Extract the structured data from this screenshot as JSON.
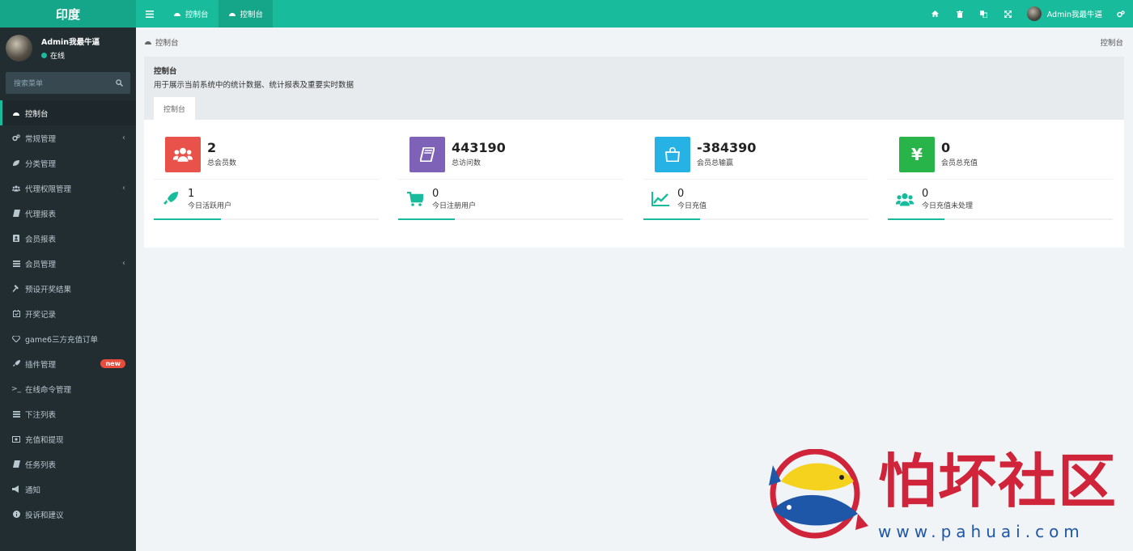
{
  "app": {
    "brand": "印度",
    "top_tabs": [
      {
        "label": "控制台",
        "active": false
      },
      {
        "label": "控制台",
        "active": true
      }
    ],
    "user_name": "Admin我最牛逼",
    "icons": [
      "home-icon",
      "trash-icon",
      "language-icon",
      "fullscreen-icon",
      "settings-icon"
    ]
  },
  "sidebar": {
    "user_name": "Admin我最牛逼",
    "status": "在线",
    "search_placeholder": "搜索菜单",
    "items": [
      {
        "label": "控制台",
        "active": true
      },
      {
        "label": "常规管理",
        "chevron": true
      },
      {
        "label": "分类管理"
      },
      {
        "label": "代理权限管理",
        "chevron": true
      },
      {
        "label": "代理报表"
      },
      {
        "label": "会员报表"
      },
      {
        "label": "会员管理",
        "chevron": true
      },
      {
        "label": "预设开奖结果"
      },
      {
        "label": "开奖记录"
      },
      {
        "label": "game6三方充值订单"
      },
      {
        "label": "插件管理",
        "badge": "new"
      },
      {
        "label": "在线命令管理"
      },
      {
        "label": "下注列表"
      },
      {
        "label": "充值和提现"
      },
      {
        "label": "任务列表"
      },
      {
        "label": "通知"
      },
      {
        "label": "投诉和建议"
      }
    ]
  },
  "breadcrumb": {
    "left": "控制台",
    "right": "控制台"
  },
  "panel": {
    "title": "控制台",
    "desc": "用于展示当前系统中的统计数据、统计报表及重要实时数据",
    "tab": "控制台"
  },
  "stats": [
    {
      "value": "2",
      "label": "总会员数",
      "color": "#e9524a",
      "icon": "users-icon",
      "b_value": "1",
      "b_label": "今日活跃用户",
      "b_icon": "rocket-icon",
      "progress": 0.3
    },
    {
      "value": "443190",
      "label": "总访问数",
      "color": "#7d62b8",
      "icon": "book-icon",
      "b_value": "0",
      "b_label": "今日注册用户",
      "b_icon": "cart-icon",
      "progress": 0.25
    },
    {
      "value": "-384390",
      "label": "会员总输赢",
      "color": "#26b2e4",
      "icon": "shopping-bag-icon",
      "b_value": "0",
      "b_label": "今日充值",
      "b_icon": "chart-line-icon",
      "progress": 0.25
    },
    {
      "value": "0",
      "label": "会员总充值",
      "color": "#29b44a",
      "icon": "yen-icon",
      "b_value": "0",
      "b_label": "今日充值未处理",
      "b_icon": "users-icon",
      "progress": 0.25
    }
  ],
  "watermark": {
    "text": "怕坏社区",
    "url": "www.pahuai.com"
  }
}
